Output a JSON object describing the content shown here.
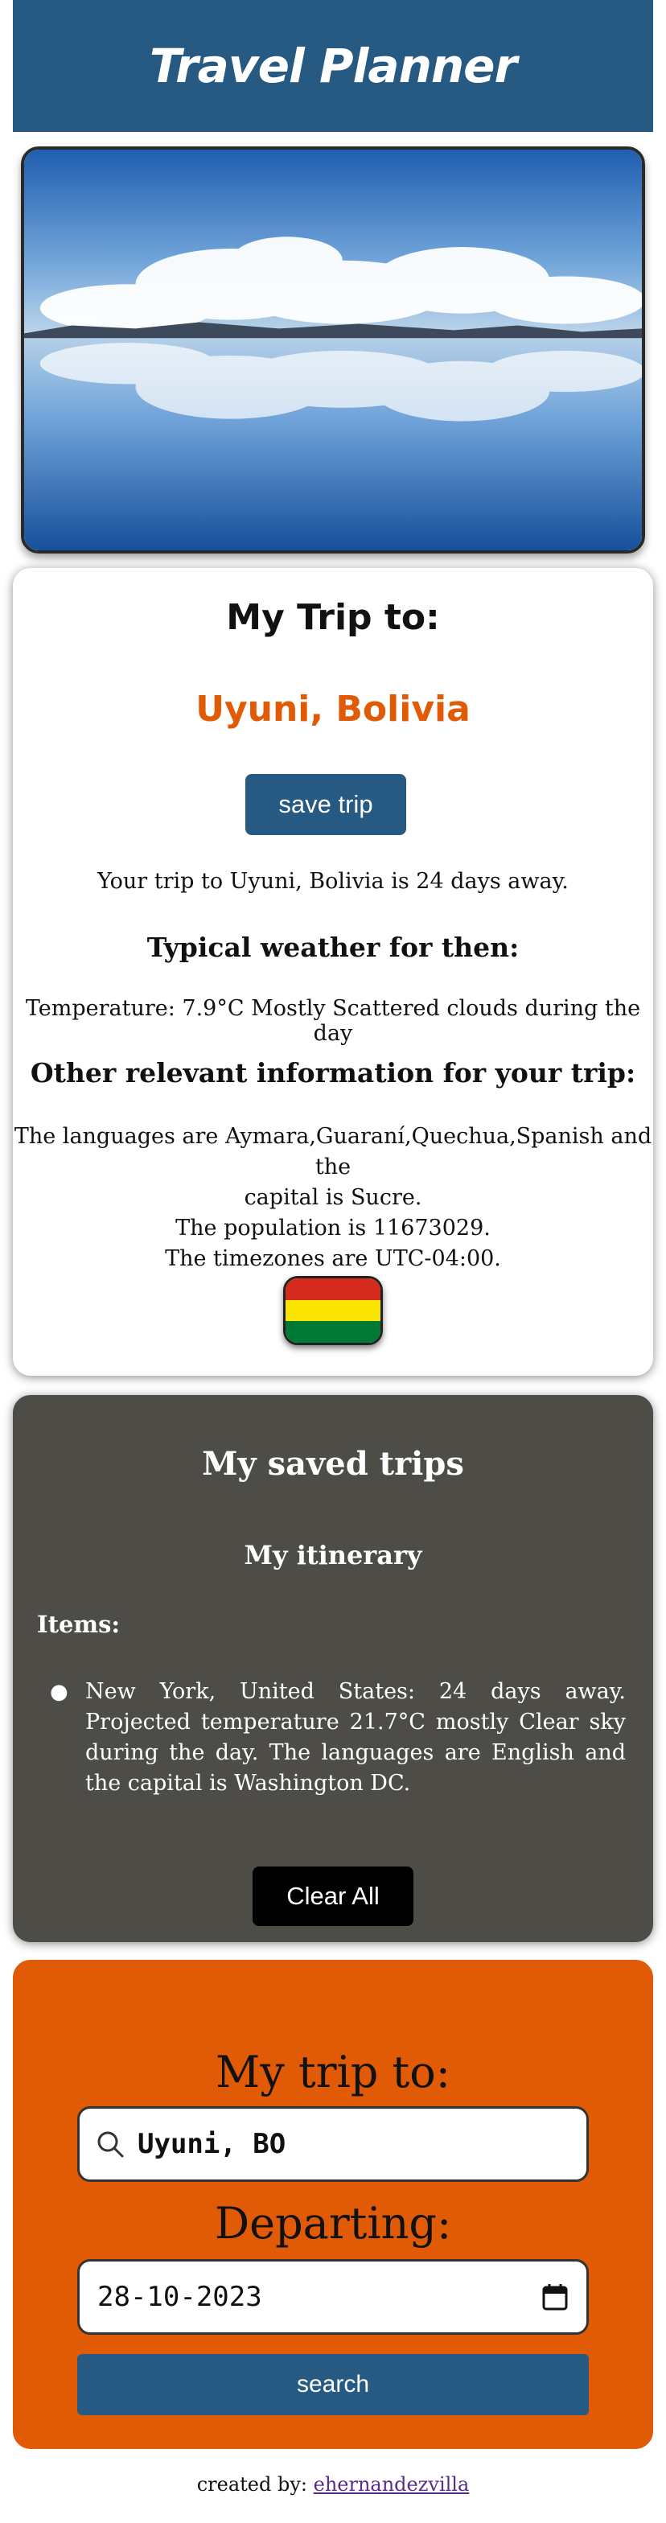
{
  "header": {
    "title": "Travel Planner"
  },
  "trip": {
    "heading": "My Trip to:",
    "destination": "Uyuni, Bolivia",
    "save_label": "save trip",
    "days_away_text": "Your trip to Uyuni, Bolivia is 24 days away.",
    "weather_heading": "Typical weather for then:",
    "weather_text": "Temperature: 7.9°C Mostly Scattered clouds during the day",
    "other_heading": "Other relevant information for your trip:",
    "info_line1": "The languages are Aymara,Guaraní,Quechua,Spanish and the",
    "info_line2": "capital is Sucre.",
    "info_line3": "The population is 11673029.",
    "info_line4": "The timezones are UTC-04:00.",
    "flag_colors": [
      "#d52b1e",
      "#f9e300",
      "#007934"
    ]
  },
  "saved": {
    "heading": "My saved trips",
    "itinerary": "My itinerary",
    "items_label": "Items:",
    "items": [
      "New York, United States: 24 days away. Projected temperature 21.7°C mostly Clear sky during the day. The languages are English and the capital is Washington DC."
    ],
    "clear_label": "Clear All"
  },
  "form": {
    "destination_label": "My trip to:",
    "destination_value": "Uyuni, BO",
    "departing_label": "Departing:",
    "departing_value": "28-10-2023",
    "search_label": "search"
  },
  "footer": {
    "prefix": "created by:",
    "author": "ehernandezvilla"
  },
  "colors": {
    "header_bg": "#265a82",
    "accent_orange": "#e15a06",
    "saved_bg": "#4e4c47"
  },
  "icons": [
    "search-icon",
    "calendar-icon"
  ]
}
